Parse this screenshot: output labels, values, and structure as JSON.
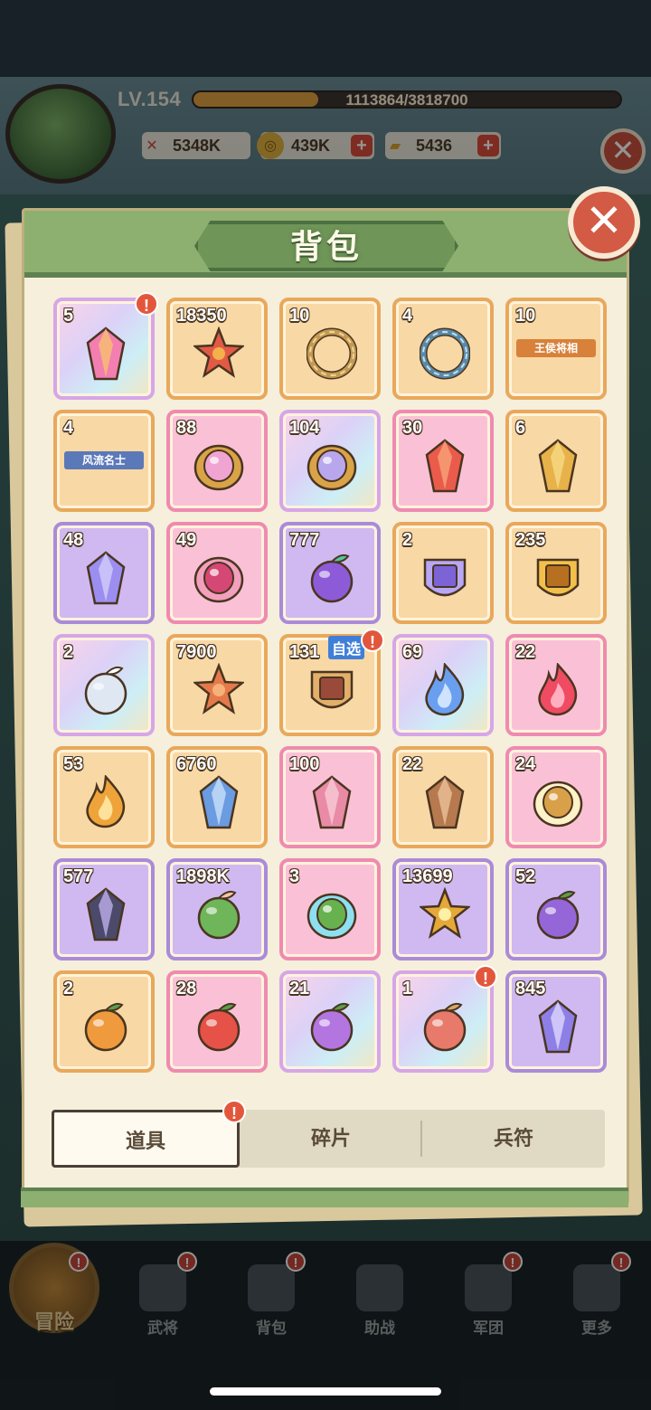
{
  "hud": {
    "level": "LV.154",
    "xp_text": "1113864/3818700",
    "xp_progress": 0.2917,
    "resources": [
      {
        "icon": "crossed-swords-icon",
        "value": "5348K",
        "has_plus": false
      },
      {
        "icon": "copper-coin-icon",
        "value": "439K",
        "has_plus": true
      },
      {
        "icon": "gold-ingot-icon",
        "value": "5436",
        "has_plus": true
      }
    ],
    "plus_glyph": "+",
    "close_glyph": "✕"
  },
  "panel": {
    "title": "背包",
    "close_glyph": "✕",
    "alert_glyph": "!",
    "items": [
      {
        "count": "5",
        "rarity": "rainbow",
        "icon": "pink-crystal-icon",
        "alert": true
      },
      {
        "count": "18350",
        "rarity": "orange",
        "icon": "red-star-icon"
      },
      {
        "count": "10",
        "rarity": "orange",
        "icon": "gold-laurel-ring-icon"
      },
      {
        "count": "4",
        "rarity": "orange",
        "icon": "wave-ring-icon"
      },
      {
        "count": "10",
        "rarity": "orange",
        "icon": "name-plate-icon",
        "label": "王侯将相"
      },
      {
        "count": "4",
        "rarity": "orange",
        "icon": "name-plate-icon",
        "label": "风流名士"
      },
      {
        "count": "88",
        "rarity": "pink",
        "icon": "pink-gem-amulet-icon"
      },
      {
        "count": "104",
        "rarity": "rainbow",
        "icon": "opal-amulet-icon"
      },
      {
        "count": "30",
        "rarity": "pink",
        "icon": "red-crystal-icon"
      },
      {
        "count": "6",
        "rarity": "orange",
        "icon": "amber-crystal-icon"
      },
      {
        "count": "48",
        "rarity": "purple",
        "icon": "purple-crystal-icon"
      },
      {
        "count": "49",
        "rarity": "pink",
        "icon": "ruby-gem-icon"
      },
      {
        "count": "777",
        "rarity": "purple",
        "icon": "orb-bowl-icon"
      },
      {
        "count": "2",
        "rarity": "orange",
        "icon": "purple-general-badge-icon"
      },
      {
        "count": "235",
        "rarity": "orange",
        "icon": "gold-general-badge-icon"
      },
      {
        "count": "2",
        "rarity": "rainbow",
        "icon": "pearl-orb-icon"
      },
      {
        "count": "7900",
        "rarity": "orange",
        "icon": "coral-branch-icon"
      },
      {
        "count": "131",
        "rarity": "orange",
        "icon": "hero-portrait-chest-icon",
        "alert": true,
        "tag": "自选"
      },
      {
        "count": "69",
        "rarity": "rainbow",
        "icon": "blue-flame-icon"
      },
      {
        "count": "22",
        "rarity": "pink",
        "icon": "red-flame-icon"
      },
      {
        "count": "53",
        "rarity": "orange",
        "icon": "gold-flame-icon"
      },
      {
        "count": "6760",
        "rarity": "orange",
        "icon": "blue-ore-icon"
      },
      {
        "count": "100",
        "rarity": "pink",
        "icon": "pink-pillar-crystal-icon"
      },
      {
        "count": "22",
        "rarity": "orange",
        "icon": "brown-pillar-crystal-icon"
      },
      {
        "count": "24",
        "rarity": "pink",
        "icon": "winged-medallion-icon"
      },
      {
        "count": "577",
        "rarity": "purple",
        "icon": "dark-crystal-cluster-icon"
      },
      {
        "count": "1898K",
        "rarity": "purple",
        "icon": "green-leaf-bundle-icon"
      },
      {
        "count": "3",
        "rarity": "pink",
        "icon": "leaf-gem-icon"
      },
      {
        "count": "13699",
        "rarity": "purple",
        "icon": "star-key-icon"
      },
      {
        "count": "52",
        "rarity": "purple",
        "icon": "purple-fruit-icon"
      },
      {
        "count": "2",
        "rarity": "orange",
        "icon": "orange-fruit-icon"
      },
      {
        "count": "28",
        "rarity": "pink",
        "icon": "red-fruit-icon"
      },
      {
        "count": "21",
        "rarity": "rainbow",
        "icon": "violet-fruit-icon"
      },
      {
        "count": "1",
        "rarity": "rainbow",
        "icon": "fruit-basket-icon",
        "alert": true
      },
      {
        "count": "845",
        "rarity": "purple",
        "icon": "lavender-shard-icon"
      }
    ],
    "tabs": [
      {
        "label": "道具",
        "active": true,
        "alert": true
      },
      {
        "label": "碎片",
        "active": false,
        "alert": false
      },
      {
        "label": "兵符",
        "active": false,
        "alert": false
      }
    ]
  },
  "nav": [
    {
      "label": "冒险",
      "icon": "crossed-swords-icon",
      "main": true,
      "alert": true
    },
    {
      "label": "武将",
      "icon": "helmet-icon",
      "alert": true
    },
    {
      "label": "背包",
      "icon": "bag-icon",
      "alert": true
    },
    {
      "label": "助战",
      "icon": "crossed-blades-icon",
      "alert": false
    },
    {
      "label": "军团",
      "icon": "banner-shield-icon",
      "alert": true
    },
    {
      "label": "更多",
      "icon": "grid-plus-icon",
      "alert": true
    }
  ],
  "colors": {
    "panel_green": "#8daf70",
    "orange_slot": "#f8d8a5",
    "pink_slot": "#fac1d6",
    "purple_slot": "#cfb9f0",
    "alert_red": "#e2573c"
  }
}
